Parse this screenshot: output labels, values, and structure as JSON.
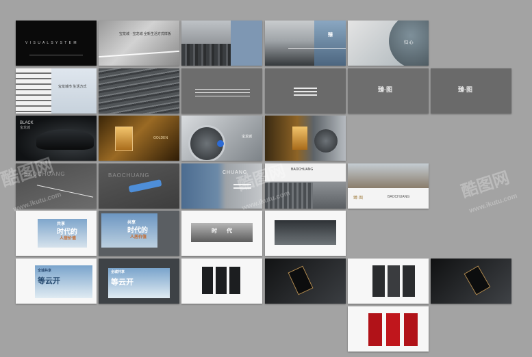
{
  "slides": {
    "r1c1_logo": "V I S U A L   S Y S T E M",
    "r1c2_title": "宝龙城 · 宝龙城  全新生活方式样板",
    "r1c4_cn": "臻",
    "r1c5_cn": "归  心",
    "r2c1_cn": "宝龙城市 生活方式",
    "r2c5_logo": "臻·图",
    "r2c6_logo": "臻·图",
    "r3c1_en": "BLACK",
    "r3c1_sub": "宝龙城",
    "r3c2_en": "GOLDEN",
    "r3c3_cn": "宝龙城",
    "r4c1_en": "BAOCHUANG",
    "r4c2_en": "BAOCHUANG",
    "r4c3_en": "CHUANG",
    "r4c4_en": "BAOCHUANG",
    "r4c5_en": "BAOCHUANG",
    "r4c5_logo": "臻·图",
    "r5c1_cn1": "共享",
    "r5c1_cn2": "时代的",
    "r5c1_cn3": "人居价值",
    "r5c2_cn1": "共享",
    "r5c2_cn2": "时代的",
    "r5c2_cn3": "人居价值",
    "r5c3_cn1": "时",
    "r5c3_cn2": "代",
    "r6c1_cn1": "全城共享",
    "r6c1_cn2": "等云开",
    "r6c2_cn1": "全城共享",
    "r6c2_cn2": "等云开"
  },
  "watermarks": {
    "brand_cn": "酷图网",
    "domain": "www.ikutu.com"
  }
}
